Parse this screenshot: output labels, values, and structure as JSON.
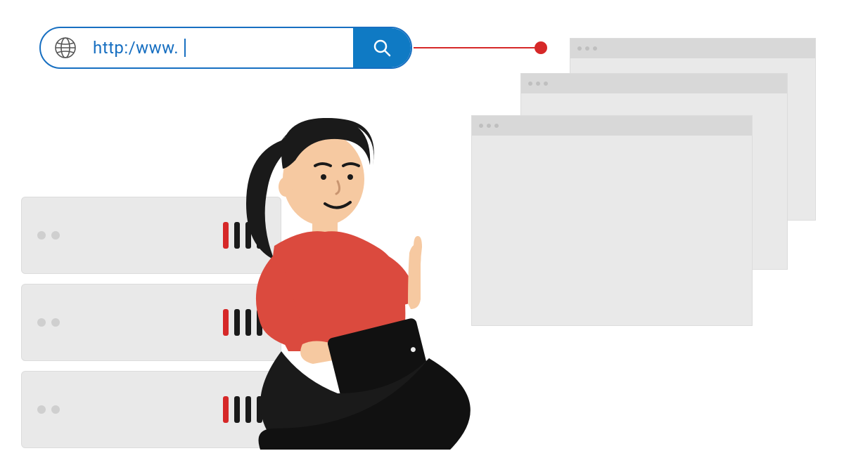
{
  "url_bar": {
    "value": "http:/www.",
    "globe_icon": "globe-icon",
    "search_icon": "search-icon"
  },
  "colors": {
    "accent_blue": "#176fc1",
    "accent_red": "#d62828",
    "panel_grey": "#e9e9e9",
    "shirt_red": "#db4a3e",
    "skin": "#f6c9a1",
    "hair": "#1a1a1a"
  }
}
